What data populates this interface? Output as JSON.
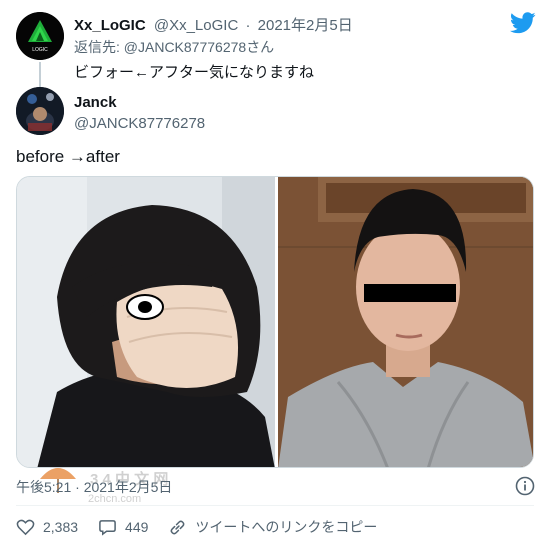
{
  "reply_tweet": {
    "author_name": "Xx_LoGIC",
    "author_handle": "@Xx_LoGIC",
    "separator": "·",
    "date": "2021年2月5日",
    "replying_prefix": "返信先: ",
    "replying_target": "@JANCK87776278",
    "replying_suffix": "さん",
    "text": "ビフォー←アフター気になりますね",
    "avatar_label": "LOGIC"
  },
  "main_tweet": {
    "author_name": "Janck",
    "author_handle": "@JANCK87776278",
    "text": "before →after",
    "timestamp": "午後5:21 · 2021年2月5日"
  },
  "actions": {
    "like_count": "2,383",
    "reply_count": "449",
    "copy_link_label": "ツイートへのリンクをコピー"
  },
  "watermark": {
    "main": "3 4 中 文 网",
    "sub": "2chcn.com"
  },
  "colors": {
    "twitter_blue": "#1d9bf0",
    "secondary_text": "#536471",
    "primary_text": "#0f1419"
  }
}
